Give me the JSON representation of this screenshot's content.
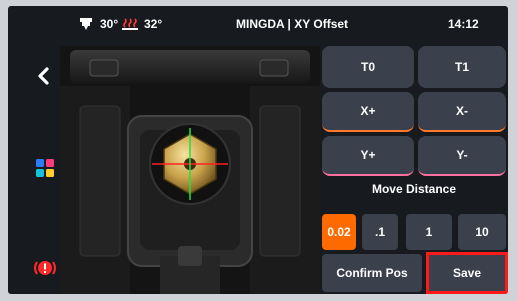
{
  "header": {
    "title": "MINGDA | XY Offset",
    "time": "14:12",
    "temps": [
      {
        "icon": "nozzle-heat-icon",
        "value": "30°"
      },
      {
        "icon": "bed-heat-icon",
        "value": "32°"
      }
    ]
  },
  "controls": {
    "tools": [
      "T0",
      "T1"
    ],
    "x_plus": "X+",
    "x_minus": "X-",
    "y_plus": "Y+",
    "y_minus": "Y-",
    "move_distance_label": "Move Distance",
    "distances": [
      "0.02",
      ".1",
      "1",
      "10"
    ],
    "selected_distance": "0.02",
    "confirm_label": "Confirm Pos",
    "save_label": "Save"
  },
  "colors": {
    "accent_orange": "#ff6a00",
    "x_underline": "#ff7a2a",
    "y_underline": "#ff6fa0",
    "highlight_red": "#ff1a1a"
  }
}
